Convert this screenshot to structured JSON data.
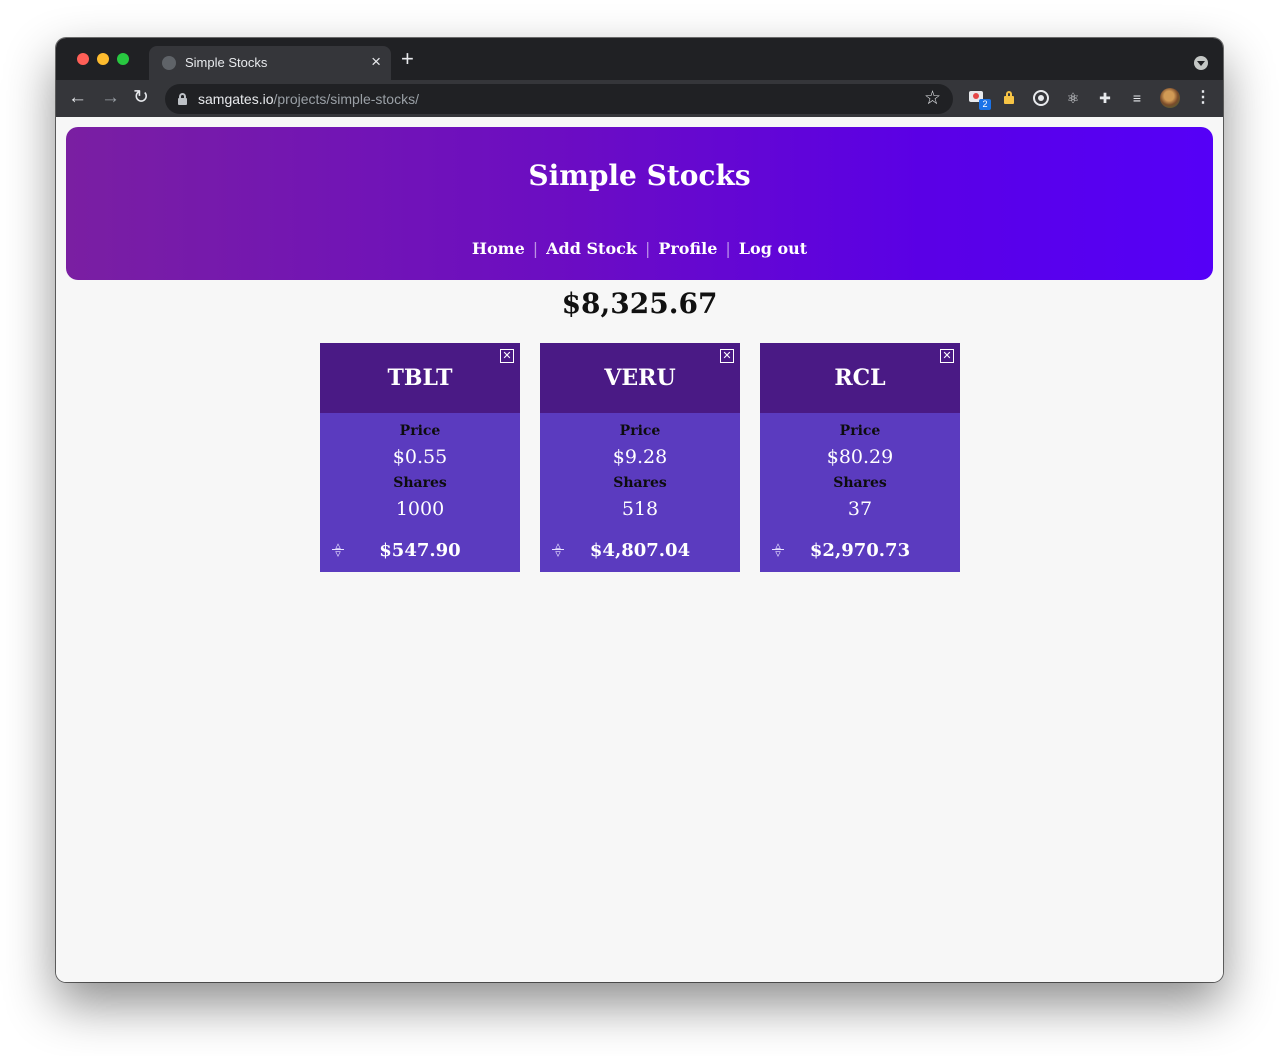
{
  "browser": {
    "tab_title": "Simple Stocks",
    "tab_close": "×",
    "new_tab": "+",
    "url_host": "samgates.io",
    "url_path": "/projects/simple-stocks/",
    "extension_badge": "2"
  },
  "header": {
    "title": "Simple Stocks",
    "nav": [
      "Home",
      "Add Stock",
      "Profile",
      "Log out"
    ]
  },
  "portfolio_total": "$8,325.67",
  "labels": {
    "price": "Price",
    "shares": "Shares"
  },
  "stocks": [
    {
      "symbol": "TBLT",
      "price": "$0.55",
      "shares": "1000",
      "total": "$547.90"
    },
    {
      "symbol": "VERU",
      "price": "$9.28",
      "shares": "518",
      "total": "$4,807.04"
    },
    {
      "symbol": "RCL",
      "price": "$80.29",
      "shares": "37",
      "total": "$2,970.73"
    }
  ],
  "colors": {
    "banner_start": "#7a1fa2",
    "banner_end": "#5500f7",
    "card_header": "#4a1a85",
    "card_body": "#5b3bbf"
  }
}
